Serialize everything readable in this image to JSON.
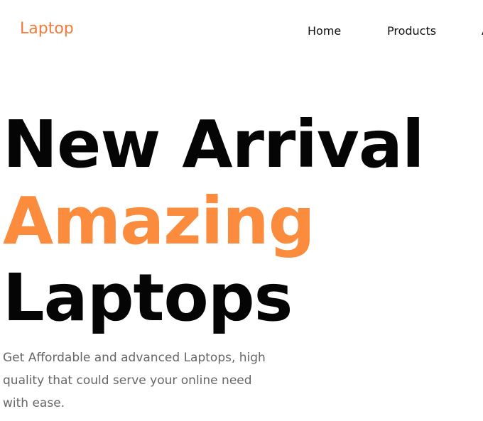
{
  "header": {
    "logo": "Laptop",
    "nav": [
      {
        "label": "Home"
      },
      {
        "label": "Products"
      },
      {
        "label": "A"
      }
    ]
  },
  "hero": {
    "line1": "New Arrival",
    "line2": "Amazing",
    "line3": "Laptops",
    "description": "Get Affordable and advanced Laptops, high quality that could serve your online need with ease."
  },
  "colors": {
    "accent": "#fb8b3d",
    "logo": "#f07a3a",
    "text": "#050505",
    "muted": "#666666"
  }
}
